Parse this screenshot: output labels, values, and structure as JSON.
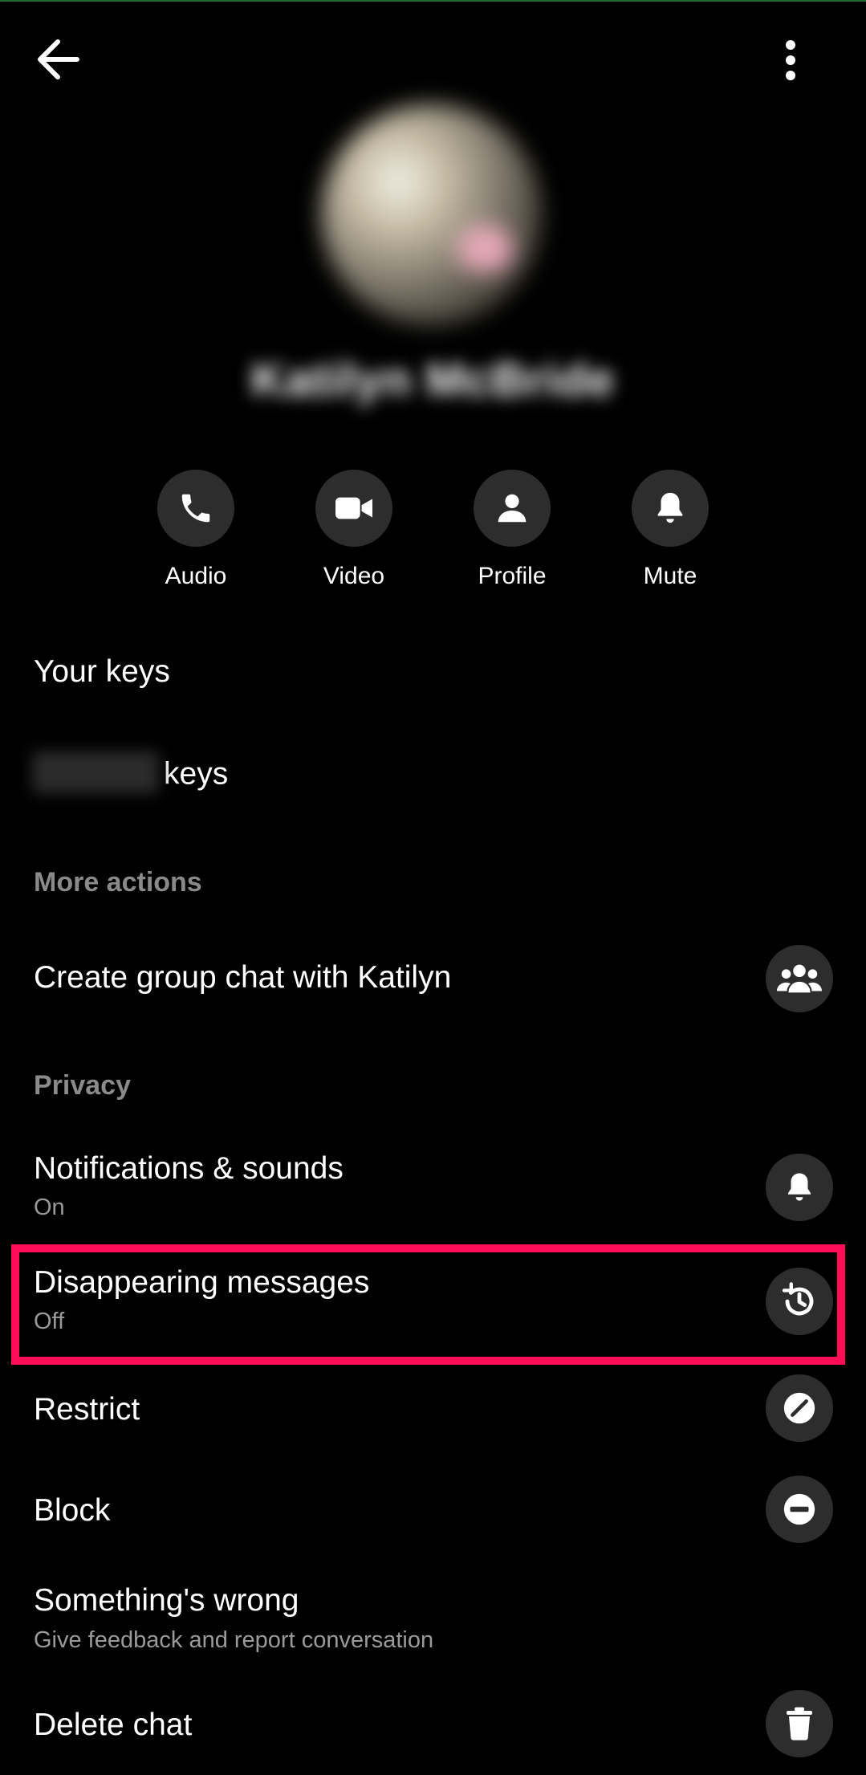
{
  "header": {
    "contact_name": "Katilyn McBride"
  },
  "actions": [
    {
      "label": "Audio",
      "icon": "phone-icon"
    },
    {
      "label": "Video",
      "icon": "video-icon"
    },
    {
      "label": "Profile",
      "icon": "person-icon"
    },
    {
      "label": "Mute",
      "icon": "bell-icon"
    }
  ],
  "keys": {
    "your_keys": "Your keys",
    "contact_keys_suffix": "keys"
  },
  "sections": {
    "more_actions": "More actions",
    "privacy": "Privacy"
  },
  "items": {
    "create_group": {
      "title": "Create group chat with Katilyn",
      "icon": "group-icon"
    },
    "notifications": {
      "title": "Notifications & sounds",
      "subtitle": "On",
      "icon": "bell-icon"
    },
    "disappearing": {
      "title": "Disappearing messages",
      "subtitle": "Off",
      "icon": "history-clock-icon"
    },
    "restrict": {
      "title": "Restrict",
      "icon": "restrict-icon"
    },
    "block": {
      "title": "Block",
      "icon": "block-icon"
    },
    "something_wrong": {
      "title": "Something's wrong",
      "subtitle": "Give feedback and report conversation"
    },
    "delete_chat": {
      "title": "Delete chat",
      "icon": "trash-icon"
    }
  },
  "colors": {
    "background": "#000000",
    "icon_circle": "#2d2d2d",
    "highlight": "#ff0d57",
    "secondary_text": "#8a8a8a"
  }
}
